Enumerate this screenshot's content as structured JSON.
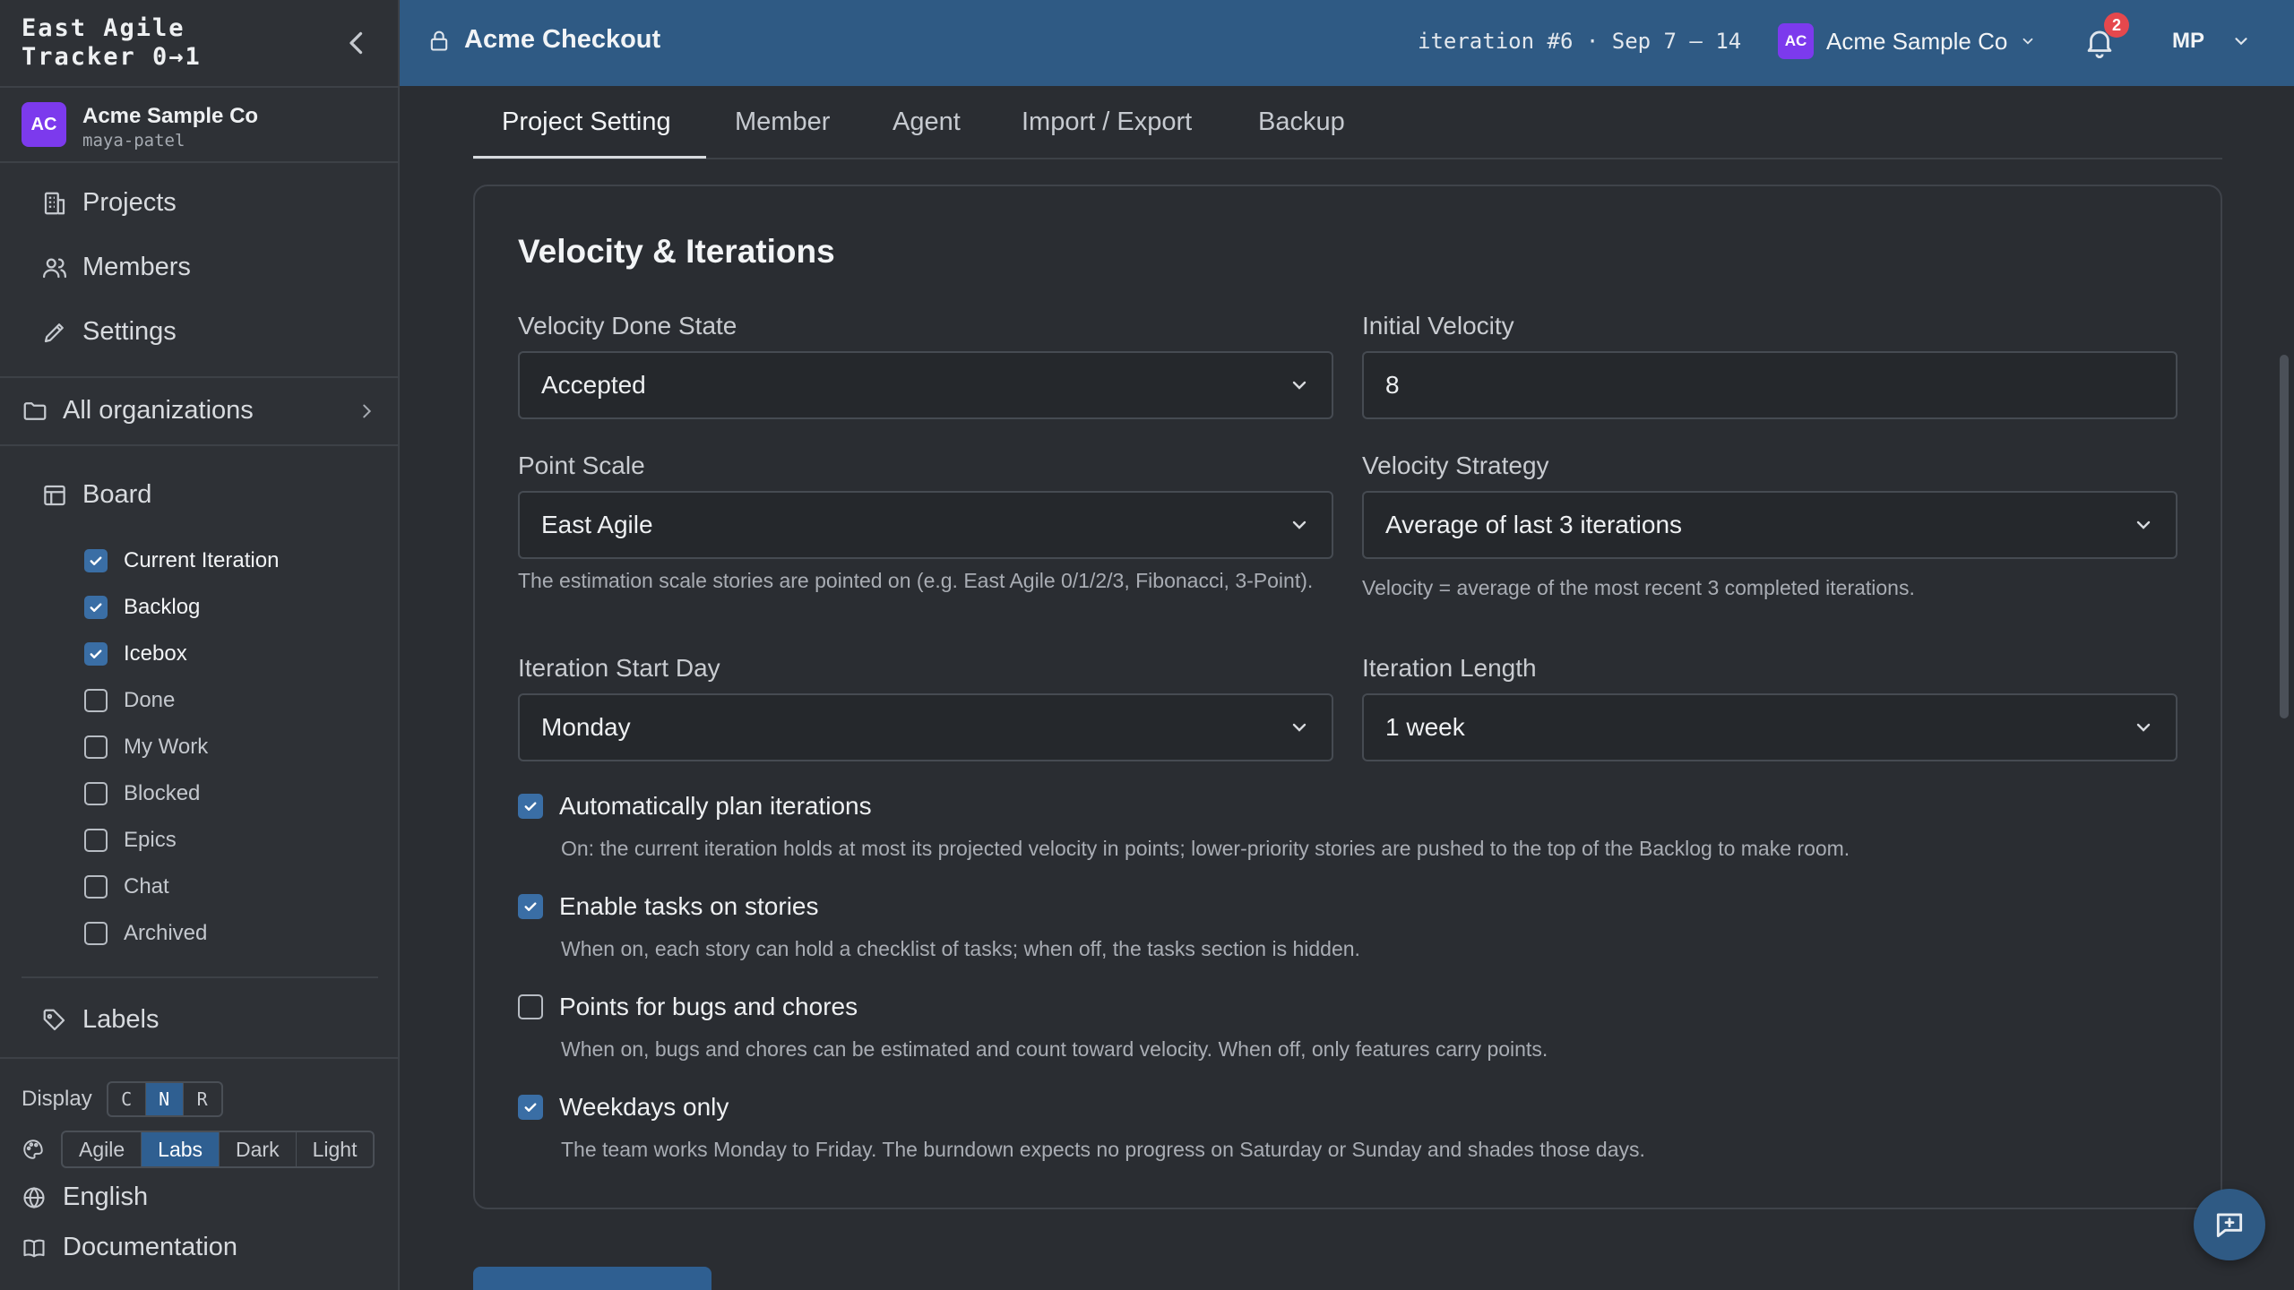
{
  "sidebar": {
    "brand_line1": "East Agile",
    "brand_line2": "Tracker 0→1",
    "org": {
      "avatar": "AC",
      "name": "Acme Sample Co",
      "user": "maya-patel",
      "avatar_color": "#7c3aed"
    },
    "nav": [
      {
        "label": "Projects",
        "icon": "building-icon"
      },
      {
        "label": "Members",
        "icon": "users-icon"
      },
      {
        "label": "Settings",
        "icon": "pencil-icon"
      }
    ],
    "all_orgs": "All organizations",
    "board": {
      "label": "Board",
      "items": [
        {
          "label": "Current Iteration",
          "checked": true
        },
        {
          "label": "Backlog",
          "checked": true
        },
        {
          "label": "Icebox",
          "checked": true
        },
        {
          "label": "Done",
          "checked": false
        },
        {
          "label": "My Work",
          "checked": false
        },
        {
          "label": "Blocked",
          "checked": false
        },
        {
          "label": "Epics",
          "checked": false
        },
        {
          "label": "Chat",
          "checked": false
        },
        {
          "label": "Archived",
          "checked": false
        }
      ]
    },
    "labels": "Labels",
    "display": {
      "label": "Display",
      "options": [
        "C",
        "N",
        "R"
      ],
      "selected": "N"
    },
    "theme": {
      "options": [
        "Agile",
        "Labs",
        "Dark",
        "Light"
      ],
      "selected": "Labs"
    },
    "language": "English",
    "documentation": "Documentation"
  },
  "topbar": {
    "project": "Acme Checkout",
    "iteration": "iteration #6 · Sep 7 – 14",
    "org_avatar": "AC",
    "org_name": "Acme Sample Co",
    "notifications": "2",
    "user_initials": "MP"
  },
  "tabs": [
    "Project Setting",
    "Member",
    "Agent",
    "Import / Export",
    "Backup"
  ],
  "active_tab": "Project Setting",
  "card": {
    "title": "Velocity & Iterations",
    "fields": {
      "done_state": {
        "label": "Velocity Done State",
        "value": "Accepted"
      },
      "initial_velocity": {
        "label": "Initial Velocity",
        "value": "8"
      },
      "point_scale": {
        "label": "Point Scale",
        "value": "East Agile",
        "hint": "The estimation scale stories are pointed on (e.g. East Agile 0/1/2/3, Fibonacci, 3-Point)."
      },
      "strategy": {
        "label": "Velocity Strategy",
        "value": "Average of last 3 iterations",
        "hint": "Velocity = average of the most recent 3 completed iterations."
      },
      "start_day": {
        "label": "Iteration Start Day",
        "value": "Monday"
      },
      "length": {
        "label": "Iteration Length",
        "value": "1 week"
      }
    },
    "options": [
      {
        "label": "Automatically plan iterations",
        "checked": true,
        "desc": "On: the current iteration holds at most its projected velocity in points; lower-priority stories are pushed to the top of the Backlog to make room."
      },
      {
        "label": "Enable tasks on stories",
        "checked": true,
        "desc": "When on, each story can hold a checklist of tasks; when off, the tasks section is hidden."
      },
      {
        "label": "Points for bugs and chores",
        "checked": false,
        "desc": "When on, bugs and chores can be estimated and count toward velocity. When off, only features carry points."
      },
      {
        "label": "Weekdays only",
        "checked": true,
        "desc": "The team works Monday to Friday. The burndown expects no progress on Saturday or Sunday and shades those days."
      }
    ]
  },
  "colors": {
    "topbar": "#2f5a84",
    "accent": "#2f5f91",
    "checkbox": "#3a6ea5",
    "badge": "#e5484d"
  }
}
